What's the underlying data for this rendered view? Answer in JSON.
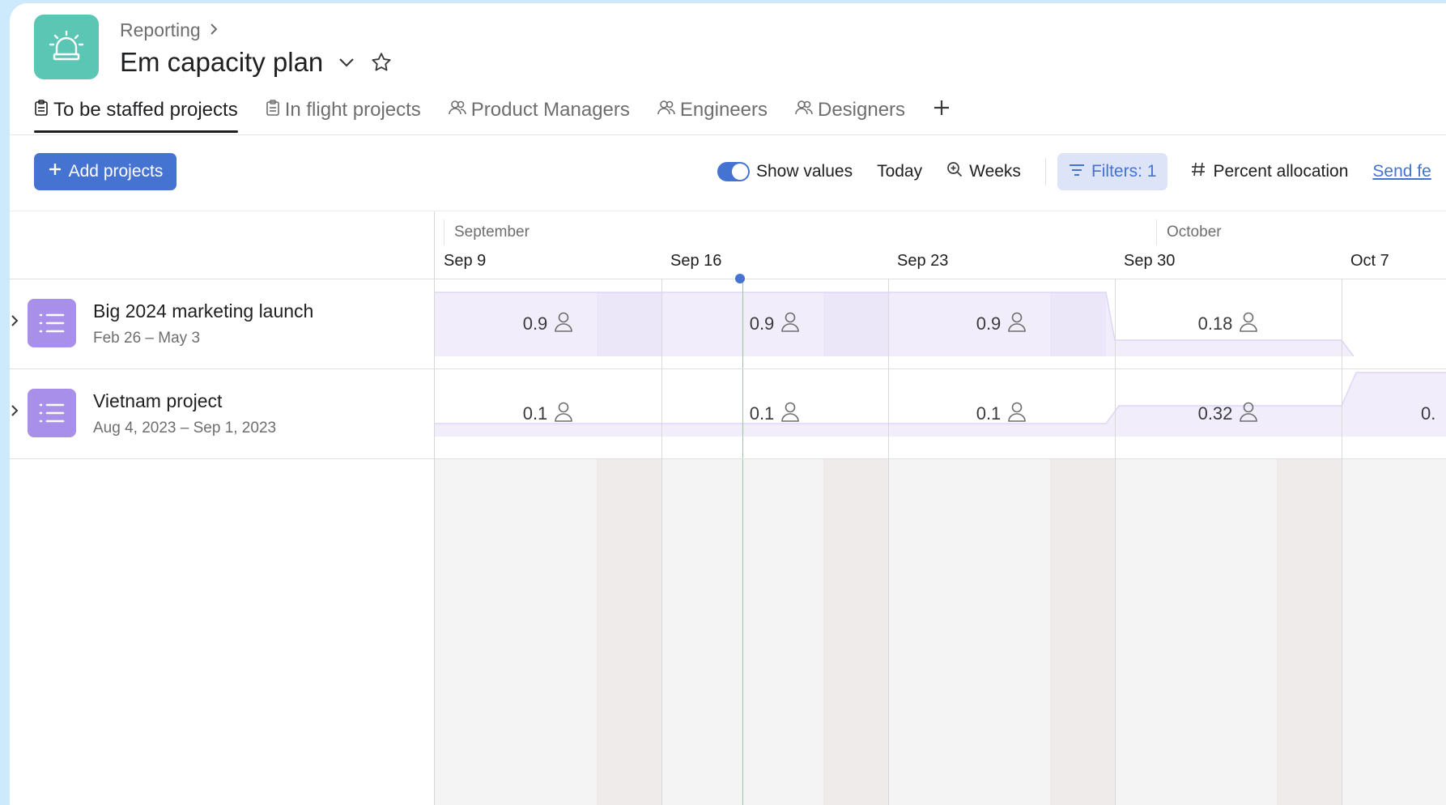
{
  "header": {
    "breadcrumb": "Reporting",
    "title": "Em capacity plan"
  },
  "tabs": [
    {
      "label": "To be staffed projects",
      "icon": "clipboard-icon",
      "active": true
    },
    {
      "label": "In flight projects",
      "icon": "clipboard-icon",
      "active": false
    },
    {
      "label": "Product Managers",
      "icon": "people-icon",
      "active": false
    },
    {
      "label": "Engineers",
      "icon": "people-icon",
      "active": false
    },
    {
      "label": "Designers",
      "icon": "people-icon",
      "active": false
    }
  ],
  "toolbar": {
    "add_label": "Add projects",
    "show_values_label": "Show values",
    "show_values_on": true,
    "today_label": "Today",
    "zoom_label": "Weeks",
    "filters_label": "Filters: 1",
    "allocation_label": "Percent allocation",
    "send_label": "Send fe"
  },
  "timeline": {
    "months": [
      "September",
      "October"
    ],
    "weeks": [
      "Sep 9",
      "Sep 16",
      "Sep 23",
      "Sep 30",
      "Oct 7"
    ]
  },
  "projects": [
    {
      "name": "Big 2024 marketing launch",
      "dates": "Feb 26 – May 3",
      "values": [
        "0.9",
        "0.9",
        "0.9",
        "0.18",
        ""
      ]
    },
    {
      "name": "Vietnam project",
      "dates": "Aug 4, 2023 – Sep 1, 2023",
      "values": [
        "0.1",
        "0.1",
        "0.1",
        "0.32",
        "0."
      ]
    }
  ],
  "colors": {
    "accent": "#4573d2",
    "app_icon": "#5cc6b4",
    "project_icon": "#a890ea",
    "allocation_fill": "#f1edfb"
  }
}
